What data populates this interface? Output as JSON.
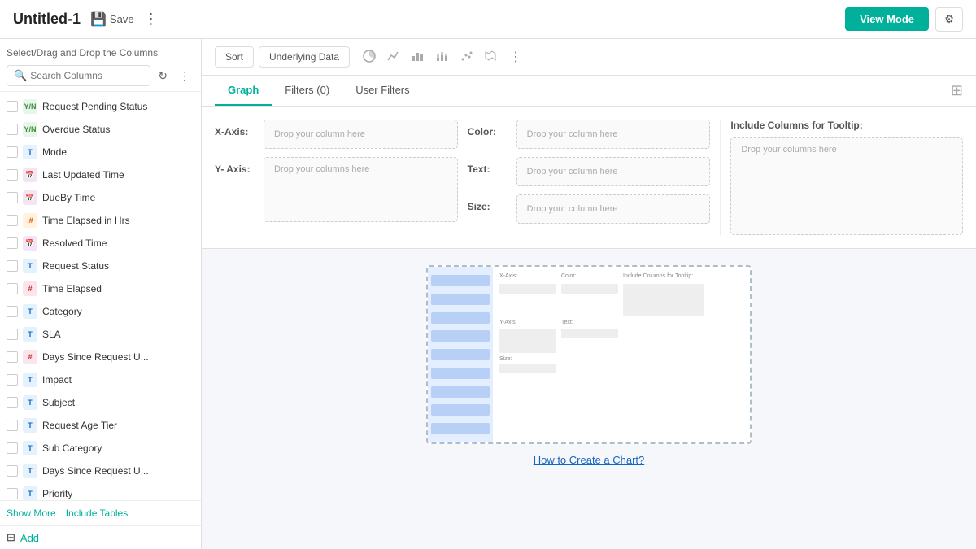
{
  "topbar": {
    "title": "Untitled-1",
    "save_label": "Save",
    "view_mode_label": "View Mode",
    "settings_icon": "⚙"
  },
  "toolbar": {
    "sort_label": "Sort",
    "underlying_data_label": "Underlying Data",
    "more_icon": "⋮"
  },
  "sidebar": {
    "header_title": "Select/Drag and Drop the Columns",
    "search_placeholder": "Search Columns",
    "refresh_icon": "↻",
    "more_icon": "⋮",
    "show_more_label": "Show More",
    "include_tables_label": "Include Tables",
    "add_label": "Add",
    "columns": [
      {
        "type": "yn",
        "badge": "Y/N",
        "label": "Request Pending Status"
      },
      {
        "type": "yn",
        "badge": "Y/N",
        "label": "Overdue Status"
      },
      {
        "type": "t",
        "badge": "T",
        "label": "Mode"
      },
      {
        "type": "date",
        "badge": "📅",
        "label": "Last Updated Time"
      },
      {
        "type": "date",
        "badge": "📅",
        "label": "DueBy Time"
      },
      {
        "type": "num",
        "badge": ".#",
        "label": "Time Elapsed in Hrs"
      },
      {
        "type": "date",
        "badge": "📅",
        "label": "Resolved Time"
      },
      {
        "type": "t",
        "badge": "T",
        "label": "Request Status"
      },
      {
        "type": "hash",
        "badge": "#",
        "label": "Time Elapsed"
      },
      {
        "type": "t",
        "badge": "T",
        "label": "Category"
      },
      {
        "type": "t",
        "badge": "T",
        "label": "SLA"
      },
      {
        "type": "hash",
        "badge": "#",
        "label": "Days Since Request U..."
      },
      {
        "type": "t",
        "badge": "T",
        "label": "Impact"
      },
      {
        "type": "t",
        "badge": "T",
        "label": "Subject"
      },
      {
        "type": "t",
        "badge": "T",
        "label": "Request Age Tier"
      },
      {
        "type": "t",
        "badge": "T",
        "label": "Sub Category"
      },
      {
        "type": "t",
        "badge": "T",
        "label": "Days Since Request U..."
      },
      {
        "type": "t",
        "badge": "T",
        "label": "Priority"
      }
    ]
  },
  "tabs": {
    "graph_label": "Graph",
    "filters_label": "Filters (0)",
    "user_filters_label": "User Filters"
  },
  "graph_config": {
    "x_axis_label": "X-Axis:",
    "y_axis_label": "Y- Axis:",
    "color_label": "Color:",
    "text_label": "Text:",
    "size_label": "Size:",
    "tooltip_label": "Include Columns for Tooltip:",
    "drop_column": "Drop your column here",
    "drop_columns": "Drop your columns here"
  },
  "preview": {
    "how_to_label": "How to Create a Chart?"
  },
  "chart_icons": [
    "🔵",
    "📈",
    "📊",
    "📶",
    "〰",
    "⬡",
    "🗺"
  ]
}
